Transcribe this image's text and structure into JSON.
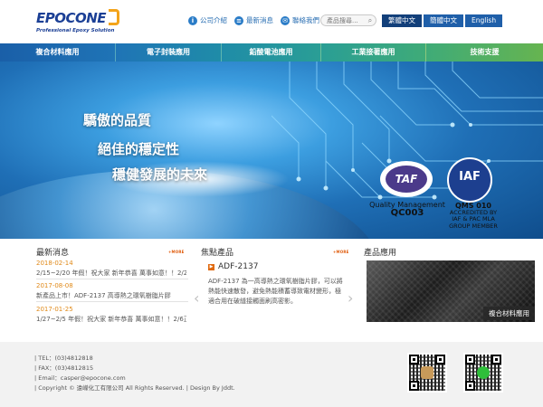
{
  "header": {
    "logo_text": "EPOCONE",
    "logo_sub": "Professional Epoxy Solution",
    "top_links": [
      {
        "label": "公司介紹",
        "icon": "info-icon"
      },
      {
        "label": "最新消息",
        "icon": "news-icon"
      },
      {
        "label": "聯絡我們",
        "icon": "mail-icon"
      }
    ],
    "search_placeholder": "產品搜尋...",
    "languages": [
      "繁體中文",
      "簡體中文",
      "English"
    ],
    "active_language": "繁體中文"
  },
  "nav": [
    {
      "label": "複合材料應用",
      "color": "#1f6fb0"
    },
    {
      "label": "電子封裝應用",
      "color": "#1f8fa8"
    },
    {
      "label": "鉛酸電池應用",
      "color": "#2a9f9a"
    },
    {
      "label": "工業接著應用",
      "color": "#3aa97d"
    },
    {
      "label": "技術支援",
      "color": "#5db05a"
    }
  ],
  "banner": {
    "slogans": [
      "驕傲的品質",
      "絕佳的穩定性",
      "穩健發展的未來"
    ],
    "cert1_logo": "TAF",
    "cert1_lines": [
      "Quality Management",
      "QC003"
    ],
    "cert2_logo": "IAF",
    "cert2_lines": [
      "QMS 010",
      "ACCREDITED BY",
      "IAF & PAC MLA",
      "GROUP MEMBER"
    ]
  },
  "news": {
    "title": "最新消息",
    "more": "+MORE",
    "items": [
      {
        "date": "2018-02-14",
        "text": "2/15~2/20 年假！祝大家 新年恭喜 萬事如意！！2/21正"
      },
      {
        "date": "2017-08-08",
        "text": "新產品上市！ADF-2137 高導熱之環氧樹脂片膠"
      },
      {
        "date": "2017-01-25",
        "text": "1/27~2/5 年假！祝大家 新年恭喜 萬事如意！！2/6正"
      }
    ]
  },
  "products": {
    "title": "焦點產品",
    "more": "+MORE",
    "name": "ADF-2137",
    "description": "ADF-2137 為一高導熱之環氧樹脂片膠，可以將熱能快速散發，避免熱能積蓄導致電材變形，極適合用在破縫接觸面刷高密影。"
  },
  "applications": {
    "title": "產品應用",
    "image_label": "複合材料應用"
  },
  "footer": {
    "lines": [
      "| TEL：(03)4812818",
      "| FAX：(03)4812815",
      "| Email：casper@epocone.com",
      "| Copyright © 遠嶸化工有限公司 All Rights Reserved. | Design By Jddt."
    ]
  },
  "colors": {
    "brand_blue": "#1b3f95",
    "brand_orange": "#f3a41b",
    "accent_orange": "#e08a1a"
  }
}
